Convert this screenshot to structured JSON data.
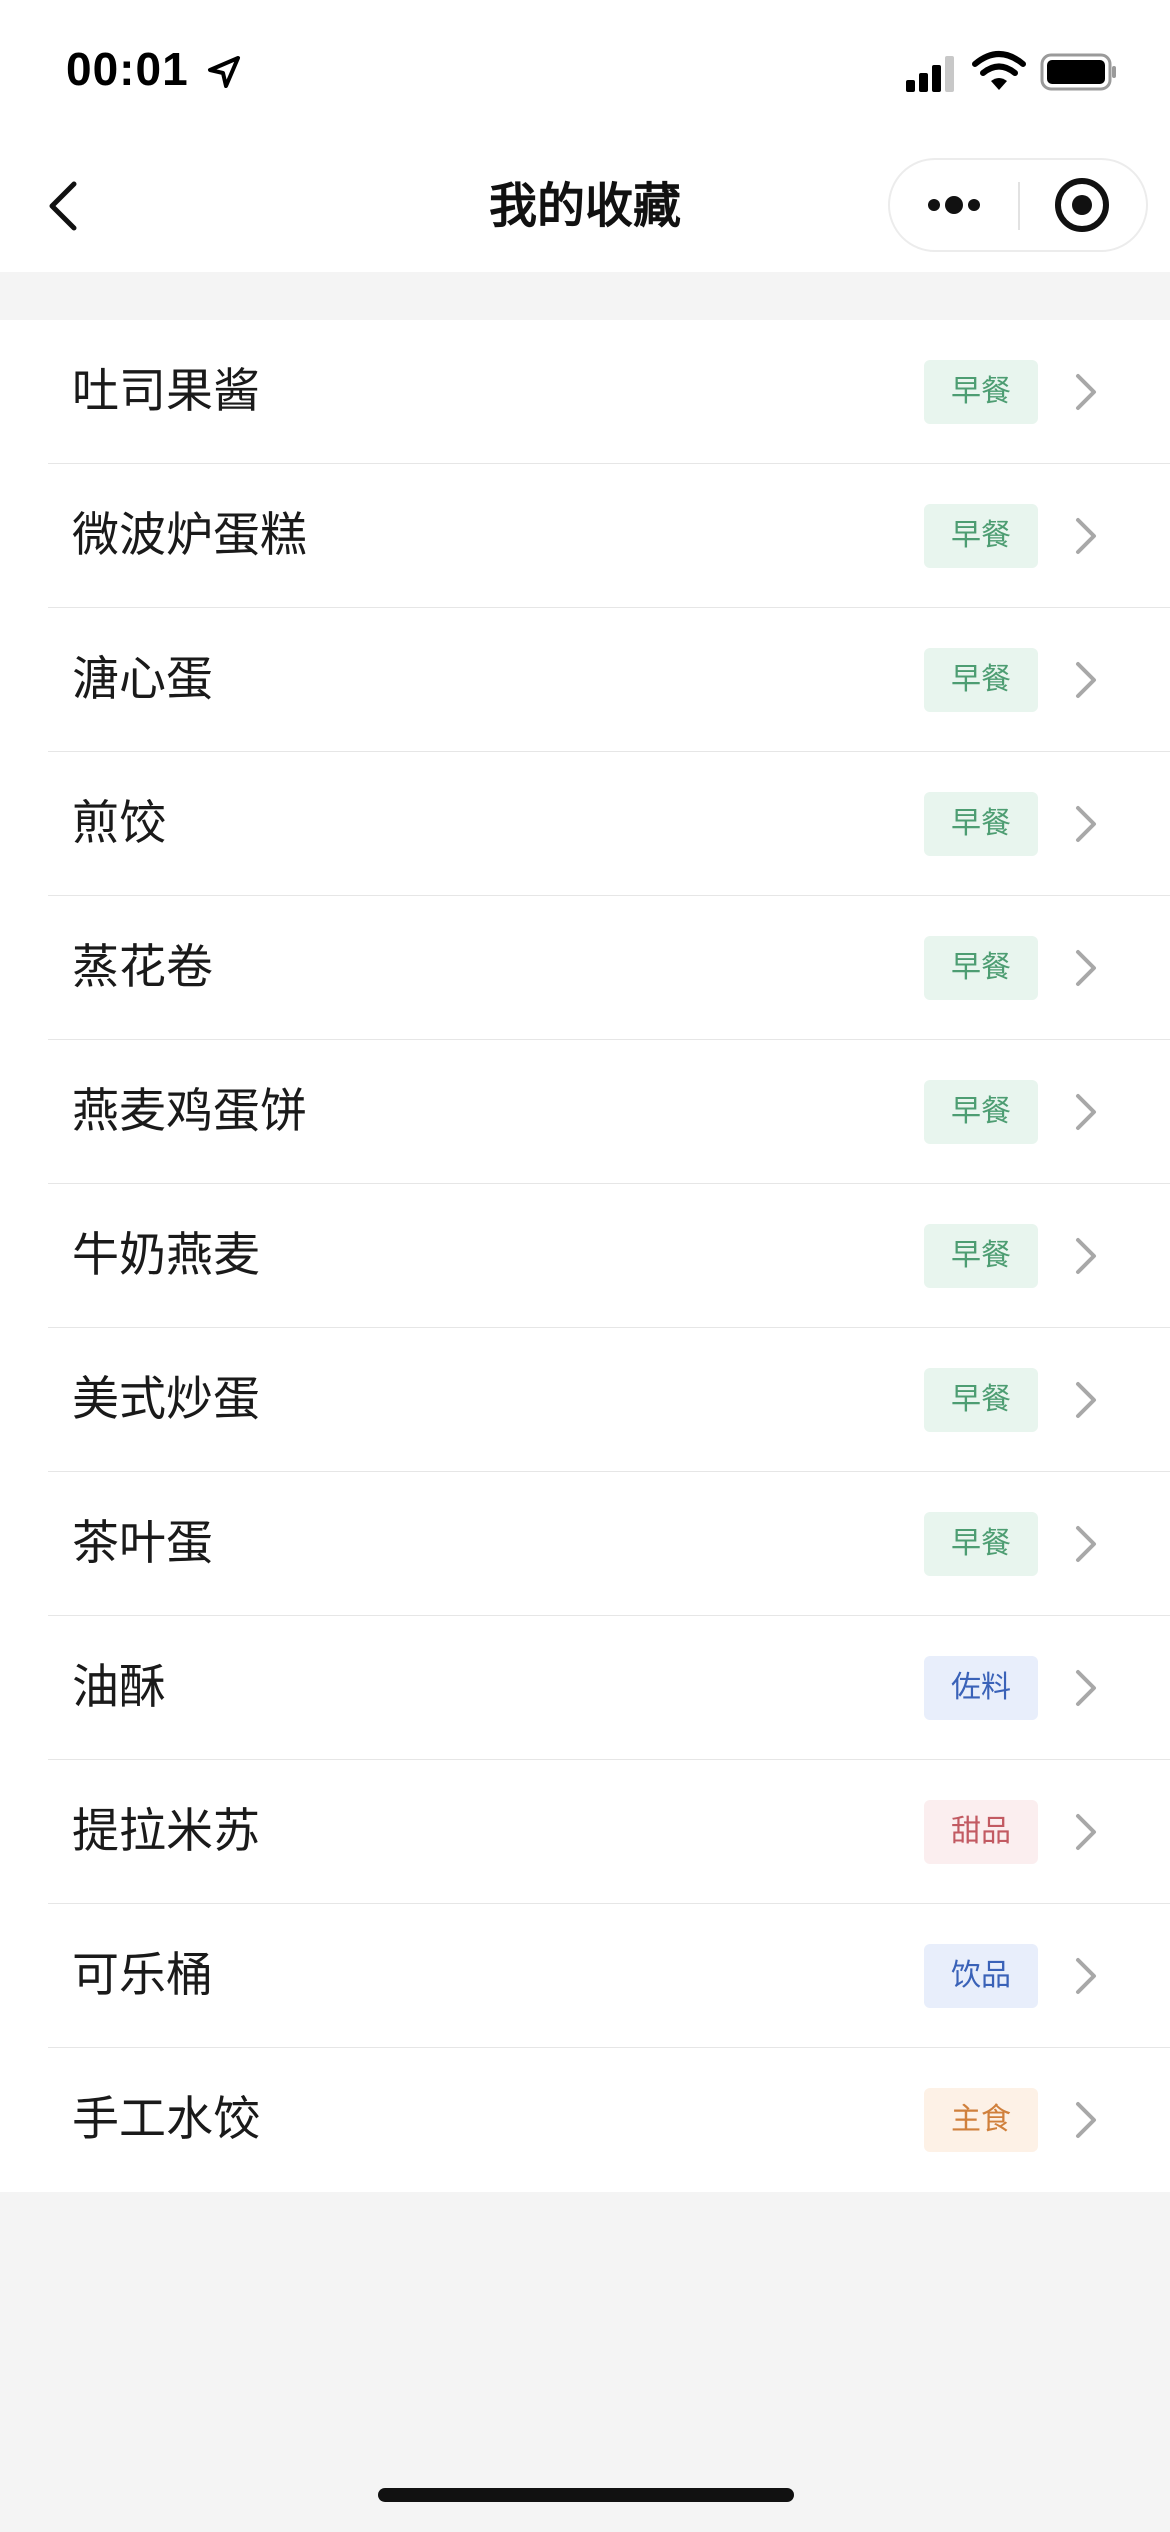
{
  "status": {
    "time": "00:01"
  },
  "header": {
    "title": "我的收藏"
  },
  "favorites": [
    {
      "name": "吐司果酱",
      "tag": "早餐",
      "tag_color": "#4d9d72"
    },
    {
      "name": "微波炉蛋糕",
      "tag": "早餐",
      "tag_color": "#4d9d72"
    },
    {
      "name": "溏心蛋",
      "tag": "早餐",
      "tag_color": "#4d9d72"
    },
    {
      "name": "煎饺",
      "tag": "早餐",
      "tag_color": "#4d9d72"
    },
    {
      "name": "蒸花卷",
      "tag": "早餐",
      "tag_color": "#4d9d72"
    },
    {
      "name": "燕麦鸡蛋饼",
      "tag": "早餐",
      "tag_color": "#4d9d72"
    },
    {
      "name": "牛奶燕麦",
      "tag": "早餐",
      "tag_color": "#4d9d72"
    },
    {
      "name": "美式炒蛋",
      "tag": "早餐",
      "tag_color": "#4d9d72"
    },
    {
      "name": "茶叶蛋",
      "tag": "早餐",
      "tag_color": "#4d9d72"
    },
    {
      "name": "油酥",
      "tag": "佐料",
      "tag_color": "#3a62b8"
    },
    {
      "name": "提拉米苏",
      "tag": "甜品",
      "tag_color": "#c25a62"
    },
    {
      "name": "可乐桶",
      "tag": "饮品",
      "tag_color": "#3a62b8"
    },
    {
      "name": "手工水饺",
      "tag": "主食",
      "tag_color": "#d0803c"
    }
  ],
  "icons": {
    "status": [
      "location-arrow-icon",
      "signal-icon",
      "wifi-icon",
      "battery-icon"
    ],
    "nav": [
      "back-chevron-icon",
      "more-dots-icon",
      "close-circle-icon"
    ],
    "row": "chevron-right-icon"
  }
}
